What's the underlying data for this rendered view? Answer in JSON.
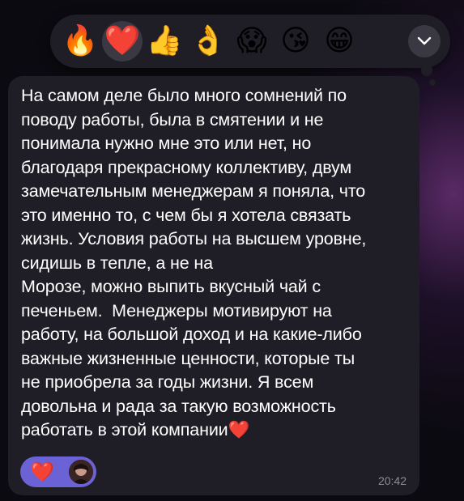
{
  "reaction_bar": {
    "reactions": [
      {
        "emoji": "🔥",
        "name": "fire",
        "selected": false
      },
      {
        "emoji": "❤️",
        "name": "heart",
        "selected": true
      },
      {
        "emoji": "👍",
        "name": "thumbs-up",
        "selected": false
      },
      {
        "emoji": "👌",
        "name": "ok-hand",
        "selected": false
      },
      {
        "emoji": "😱",
        "name": "screaming-face",
        "selected": false
      },
      {
        "emoji": "😘",
        "name": "face-blowing-kiss",
        "selected": false
      },
      {
        "emoji": "😁",
        "name": "grinning-face",
        "selected": false
      }
    ],
    "more_icon": "chevron-down-icon"
  },
  "message": {
    "text": "На самом деле было много сомнений по\nповоду работы, была в смятении и не\nпонимала нужно мне это или нет, но\nблагодаря прекрасному коллективу, двум\nзамечательным менеджерам я поняла, что\nэто именно то, с чем бы я хотела связать\nжизнь. Условия работы на высшем уровне,\nсидишь в тепле, а не на\nМорозе, можно выпить вкусный чай с\nпеченьем.  Менеджеры мотивируют на\nработу, на большой доход и на какие-либо\nважные жизненные ценности, которые ты\nне приобрела за годы жизни. Я всем\nдовольна и рада за такую возможность\nработать в этой компании❤️",
    "reaction_chip": {
      "emoji": "❤️"
    },
    "time": "20:42"
  },
  "colors": {
    "bubble": "#1f1d26",
    "reaction_chip": "#6b62d6",
    "text": "#ffffff",
    "timestamp": "#8f8c99"
  }
}
